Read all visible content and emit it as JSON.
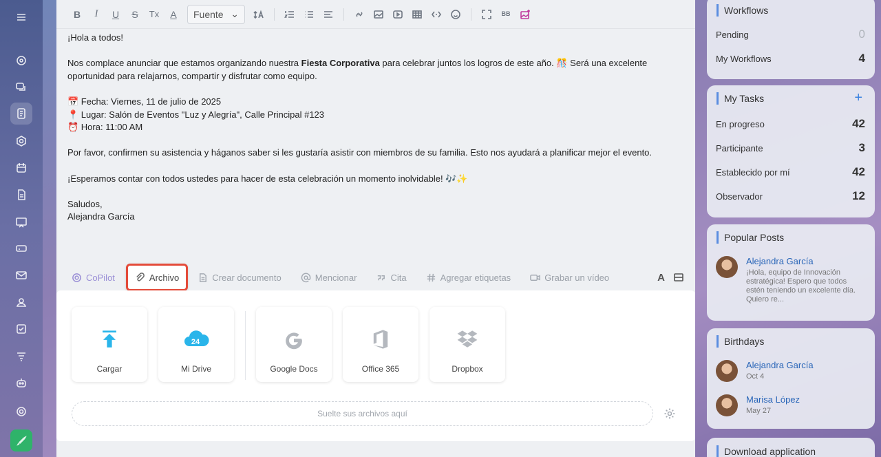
{
  "toolbar": {
    "bold": "B",
    "italic": "I",
    "underline": "U",
    "strike": "S",
    "clear_format": "Tx",
    "text_color": "A",
    "font_select": "Fuente",
    "bbcode": "BB"
  },
  "editor": {
    "lines": [
      "¡Hola a todos!",
      "",
      "Nos complace anunciar que estamos organizando nuestra ",
      "Fiesta Corporativa",
      " para celebrar juntos los logros de este año. 🎊 Será una excelente",
      "oportunidad para relajarnos, compartir y disfrutar como equipo.",
      "",
      "📅 Fecha: Viernes, 11 de julio de 2025",
      "📍 Lugar: Salón de Eventos \"Luz y Alegría\", Calle Principal #123",
      "⏰ Hora: 11:00 AM",
      "",
      "Por favor, confirmen su asistencia y háganos saber si les gustaría asistir con miembros de su familia. Esto nos ayudará a planificar mejor el evento.",
      "",
      "¡Esperamos contar con todos ustedes para hacer de esta celebración un momento inolvidable! 🎶✨",
      "",
      "Saludos,",
      "Alejandra García"
    ]
  },
  "attach_bar": {
    "copilot": "CoPilot",
    "archivo": "Archivo",
    "crear_documento": "Crear documento",
    "mencionar": "Mencionar",
    "cita": "Cita",
    "agregar_etiquetas": "Agregar etiquetas",
    "grabar_video": "Grabar un vídeo",
    "font_toggle": "A"
  },
  "upload": {
    "cards": [
      {
        "label": "Cargar",
        "icon": "upload-icon"
      },
      {
        "label": "Mi Drive",
        "icon": "cloud-24-icon",
        "badge": "24"
      },
      {
        "label": "Google Docs",
        "icon": "google-icon"
      },
      {
        "label": "Office 365",
        "icon": "office-icon"
      },
      {
        "label": "Dropbox",
        "icon": "dropbox-icon"
      }
    ],
    "dropzone": "Suelte sus archivos aquí"
  },
  "workflows": {
    "title": "Workflows",
    "rows": [
      {
        "label": "Pending",
        "value": "0"
      },
      {
        "label": "My Workflows",
        "value": "4"
      }
    ]
  },
  "tasks": {
    "title": "My Tasks",
    "add": "+",
    "rows": [
      {
        "label": "En progreso",
        "value": "42"
      },
      {
        "label": "Participante",
        "value": "3"
      },
      {
        "label": "Establecido por mí",
        "value": "42"
      },
      {
        "label": "Observador",
        "value": "12"
      }
    ]
  },
  "popular": {
    "title": "Popular Posts",
    "name": "Alejandra García",
    "excerpt": "¡Hola, equipo de Innovación estratégica! Espero que todos estén teniendo un excelente día. Quiero re..."
  },
  "birthdays": {
    "title": "Birthdays",
    "people": [
      {
        "name": "Alejandra García",
        "date": "Oct 4"
      },
      {
        "name": "Marisa López",
        "date": "May 27"
      }
    ]
  },
  "download": {
    "title": "Download application"
  },
  "colors": {
    "accent": "#5a8de0",
    "highlight_border": "#e44b3a",
    "link": "#2a66b8"
  }
}
